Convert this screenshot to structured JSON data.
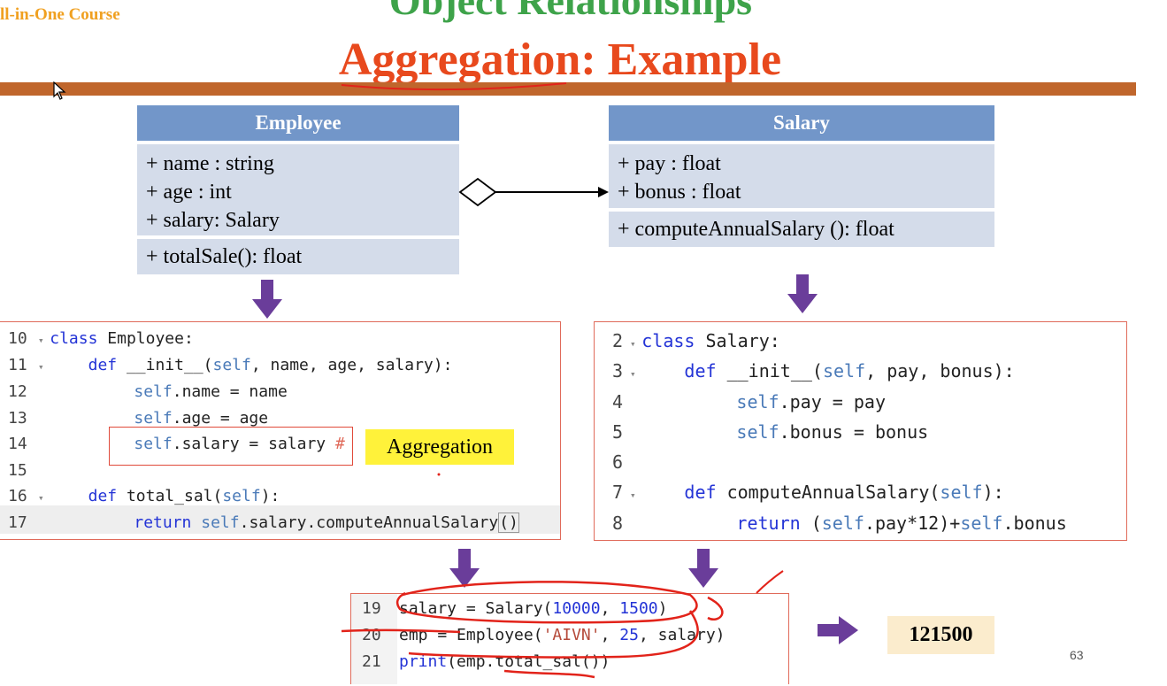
{
  "header": {
    "course": "ll-in-One Course",
    "title_top": "Object Relationships",
    "title_main": "Aggregation: Example"
  },
  "employee_uml": {
    "name": "Employee",
    "attributes": [
      "+ name : string",
      "+ age : int",
      "+ salary: Salary"
    ],
    "methods": [
      "+ totalSale(): float"
    ]
  },
  "salary_uml": {
    "name": "Salary",
    "attributes": [
      "+ pay : float",
      "+ bonus : float"
    ],
    "methods": [
      "+ computeAnnualSalary (): float"
    ]
  },
  "employee_code": {
    "line_numbers": [
      "10",
      "11",
      "12",
      "13",
      "14",
      "15",
      "16",
      "17"
    ],
    "lines": [
      {
        "k": "class",
        "t": " Employee:"
      },
      {
        "k": "def",
        "t": " __init__(self, name, age, salary):"
      },
      {
        "s": "self",
        "t": ".name = name"
      },
      {
        "s": "self",
        "t": ".age = age"
      },
      {
        "s": "self",
        "t": ".salary = salary #"
      },
      {
        "t": ""
      },
      {
        "k": "def",
        "t": " total_sal(self):"
      },
      {
        "k": "return",
        "s": "self",
        "t": ".salary.computeAnnualSalary()"
      }
    ],
    "tag": "Aggregation"
  },
  "salary_code": {
    "line_numbers": [
      "2",
      "3",
      "4",
      "5",
      "6",
      "7",
      "8"
    ],
    "lines": [
      {
        "k": "class",
        "t": " Salary:"
      },
      {
        "k": "def",
        "t": " __init__(self, pay, bonus):"
      },
      {
        "s": "self",
        "t": ".pay = pay"
      },
      {
        "s": "self",
        "t": ".bonus = bonus"
      },
      {
        "t": ""
      },
      {
        "k": "def",
        "t": " computeAnnualSalary(self):"
      },
      {
        "k": "return",
        "t": " (self.pay*12)+self.bonus"
      }
    ]
  },
  "usage_code": {
    "line_numbers": [
      "19",
      "20",
      "21"
    ],
    "lines": [
      "salary = Salary(10000, 1500)",
      "emp = Employee('AIVN', 25, salary)",
      "print(emp.total_sal())"
    ]
  },
  "output": "121500",
  "page_number": "63",
  "colors": {
    "course": "#f0a020",
    "title_top": "#3ea34a",
    "title_main": "#e8491d",
    "bar": "#c0662c",
    "uml_header": "#7296c9",
    "uml_body": "#d4dcea",
    "arrow": "#6a3d9a",
    "highlight": "#fff23a",
    "output_bg": "#fbeccd",
    "annotation": "#e2231a"
  }
}
